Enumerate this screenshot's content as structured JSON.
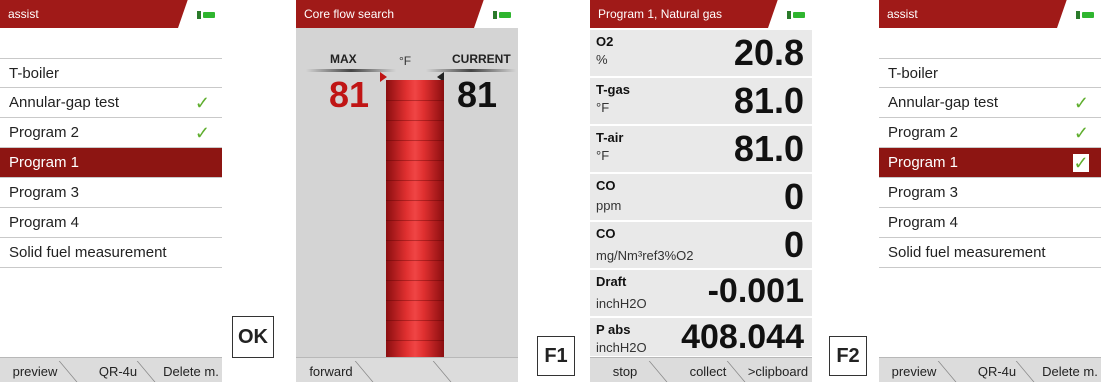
{
  "screen1": {
    "title": "assist",
    "items": [
      {
        "label": "T-boiler",
        "check": ""
      },
      {
        "label": "Annular-gap test",
        "check": "✓"
      },
      {
        "label": "Program 2",
        "check": "✓"
      },
      {
        "label": "Program 1",
        "check": ""
      },
      {
        "label": "Program 3",
        "check": ""
      },
      {
        "label": "Program 4",
        "check": ""
      },
      {
        "label": "Solid fuel measurement",
        "check": ""
      }
    ],
    "softkeys": [
      "preview",
      "QR-4u",
      "Delete m."
    ]
  },
  "key_ok": "OK",
  "screen2": {
    "title": "Core flow search",
    "max_label": "MAX",
    "unit": "°F",
    "current_label": "CURRENT",
    "max_value": "81",
    "current_value": "81",
    "softkeys": [
      "forward"
    ]
  },
  "key_f1": "F1",
  "screen3": {
    "title": "Program 1, Natural gas",
    "rows": [
      {
        "name": "O2",
        "unit": "%",
        "value": "20.8"
      },
      {
        "name": "T-gas",
        "unit": "°F",
        "value": "81.0"
      },
      {
        "name": "T-air",
        "unit": "°F",
        "value": "81.0"
      },
      {
        "name": "CO",
        "unit": "ppm",
        "value": "0"
      },
      {
        "name": "CO",
        "unit": "mg/Nm³ref3%O2",
        "value": "0"
      },
      {
        "name": "Draft",
        "unit": "inchH2O",
        "value": "-0.001"
      },
      {
        "name": "P abs",
        "unit": "inchH2O",
        "value": "408.044"
      }
    ],
    "softkeys": [
      "stop",
      "collect",
      ">clipboard"
    ]
  },
  "key_f2": "F2",
  "screen4": {
    "title": "assist",
    "items": [
      {
        "label": "T-boiler",
        "check": ""
      },
      {
        "label": "Annular-gap test",
        "check": "✓"
      },
      {
        "label": "Program 2",
        "check": "✓"
      },
      {
        "label": "Program 1",
        "check": "✓"
      },
      {
        "label": "Program 3",
        "check": ""
      },
      {
        "label": "Program 4",
        "check": ""
      },
      {
        "label": "Solid fuel measurement",
        "check": ""
      }
    ],
    "softkeys": [
      "preview",
      "QR-4u",
      "Delete m."
    ]
  },
  "colors": {
    "titlebar": "#a01a18",
    "selection": "#8d1512",
    "check": "#5fae2e",
    "battery": "#2fb52f"
  }
}
